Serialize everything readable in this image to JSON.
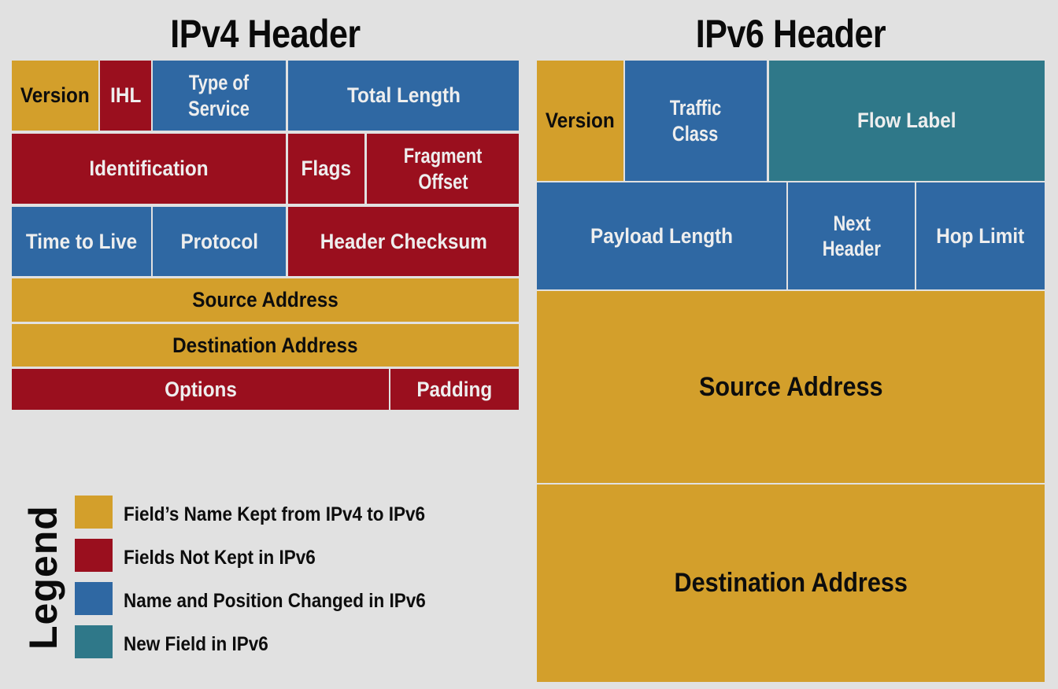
{
  "colors": {
    "kept": "#d39f2b",
    "not_kept": "#9a0f1e",
    "changed": "#2f68a3",
    "new": "#2f7889",
    "background": "#e1e1e1"
  },
  "ipv4": {
    "title": "IPv4 Header",
    "fields": {
      "version": "Version",
      "ihl": "IHL",
      "tos_line1": "Type of",
      "tos_line2": "Service",
      "total_length": "Total Length",
      "identification": "Identification",
      "flags": "Flags",
      "frag_line1": "Fragment",
      "frag_line2": "Offset",
      "ttl": "Time to Live",
      "protocol": "Protocol",
      "checksum": "Header Checksum",
      "source": "Source Address",
      "destination": "Destination Address",
      "options": "Options",
      "padding": "Padding"
    }
  },
  "ipv6": {
    "title": "IPv6 Header",
    "fields": {
      "version": "Version",
      "tc_line1": "Traffic",
      "tc_line2": "Class",
      "flow_label": "Flow Label",
      "payload_length": "Payload Length",
      "nh_line1": "Next",
      "nh_line2": "Header",
      "hop_limit": "Hop Limit",
      "source": "Source Address",
      "destination": "Destination Address"
    }
  },
  "legend": {
    "title": "Legend",
    "items": [
      {
        "label": "Field’s Name Kept from IPv4 to IPv6",
        "category": "kept"
      },
      {
        "label": "Fields Not Kept in IPv6",
        "category": "not_kept"
      },
      {
        "label": "Name and Position Changed in IPv6",
        "category": "changed"
      },
      {
        "label": "New Field in IPv6",
        "category": "new"
      }
    ]
  }
}
